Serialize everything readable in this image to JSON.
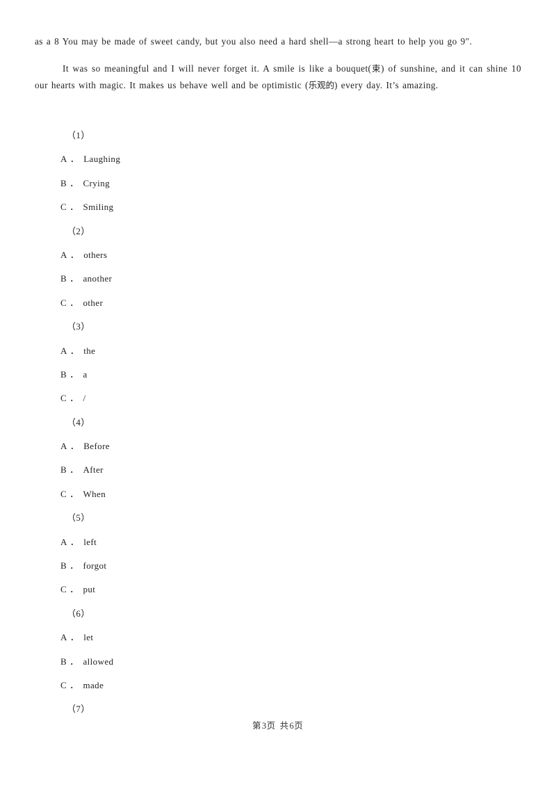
{
  "document": {
    "page_background": "#ffffff",
    "text_color": "#222222",
    "paragraphs": [
      {
        "id": "para-1",
        "text": "as a 8 You may be made of sweet candy, but you also need a hard shell—a strong heart to help you go 9″."
      },
      {
        "id": "para-2",
        "part_a": "It was so meaningful and I will never forget it. A smile is like a bouquet(",
        "cn_1": "束",
        "part_b": ") of sunshine, and it can shine 10 our hearts with magic. It makes us behave well and be optimistic (",
        "cn_2": "乐观的",
        "part_c": ") every day. It’s amazing."
      }
    ],
    "questions": [
      {
        "number": "（1）",
        "options": [
          {
            "letter": "A",
            "dot": "．",
            "text": "Laughing"
          },
          {
            "letter": "B",
            "dot": "．",
            "text": "Crying"
          },
          {
            "letter": "C",
            "dot": "．",
            "text": "Smiling"
          }
        ]
      },
      {
        "number": "（2）",
        "options": [
          {
            "letter": "A",
            "dot": "．",
            "text": "others"
          },
          {
            "letter": "B",
            "dot": "．",
            "text": "another"
          },
          {
            "letter": "C",
            "dot": "．",
            "text": "other"
          }
        ]
      },
      {
        "number": "（3）",
        "options": [
          {
            "letter": "A",
            "dot": "．",
            "text": "the"
          },
          {
            "letter": "B",
            "dot": "．",
            "text": "a"
          },
          {
            "letter": "C",
            "dot": "．",
            "text": "/"
          }
        ]
      },
      {
        "number": "（4）",
        "options": [
          {
            "letter": "A",
            "dot": "．",
            "text": "Before"
          },
          {
            "letter": "B",
            "dot": "．",
            "text": "After"
          },
          {
            "letter": "C",
            "dot": "．",
            "text": "When"
          }
        ]
      },
      {
        "number": "（5）",
        "options": [
          {
            "letter": "A",
            "dot": "．",
            "text": "left"
          },
          {
            "letter": "B",
            "dot": "．",
            "text": "forgot"
          },
          {
            "letter": "C",
            "dot": "．",
            "text": "put"
          }
        ]
      },
      {
        "number": "（6）",
        "options": [
          {
            "letter": "A",
            "dot": "．",
            "text": "let"
          },
          {
            "letter": "B",
            "dot": "．",
            "text": "allowed"
          },
          {
            "letter": "C",
            "dot": "．",
            "text": "made"
          }
        ]
      },
      {
        "number": "（7）",
        "options": []
      }
    ],
    "footer": {
      "prefix": "第",
      "current_page": "3",
      "middle": "页 共",
      "total_pages": "6",
      "suffix": "页"
    }
  }
}
